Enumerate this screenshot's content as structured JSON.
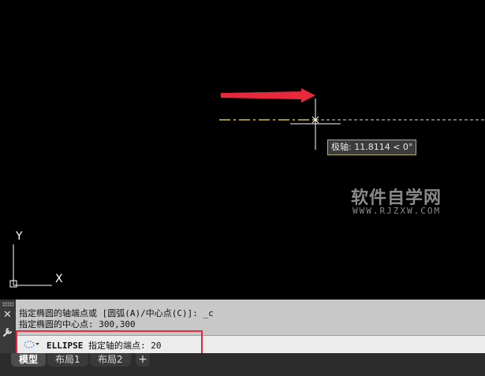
{
  "canvas": {
    "tooltip": "极轴: 11.8114 < 0°",
    "axis_x_label": "X",
    "axis_y_label": "Y",
    "watermark_cn": "软件自学网",
    "watermark_url": "WWW.RJZXW.COM",
    "arrow_color": "#e8283c"
  },
  "command": {
    "history": [
      "指定椭圆的轴端点或 [圆弧(A)/中心点(C)]: _c",
      "指定椭圆的中心点: 300,300"
    ],
    "command_name": "ELLIPSE",
    "prompt": "指定轴的端点:",
    "value": "20",
    "close_icon": "close-icon",
    "settings_icon": "wrench-icon"
  },
  "tabs": [
    {
      "label": "模型",
      "active": true
    },
    {
      "label": "布局1",
      "active": false
    },
    {
      "label": "布局2",
      "active": false
    }
  ],
  "add_tab_label": "+"
}
